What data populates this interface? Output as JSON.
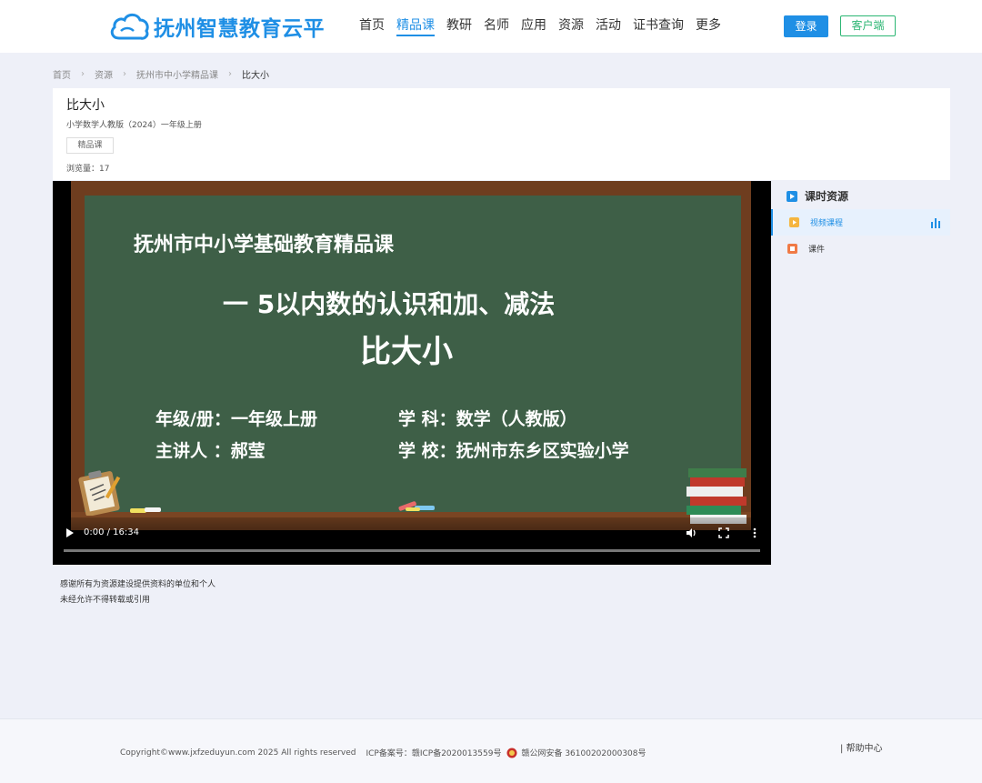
{
  "header": {
    "logo_text": "抚州智慧教育云平",
    "nav": [
      "首页",
      "精品课",
      "教研",
      "名师",
      "应用",
      "资源",
      "活动",
      "证书查询",
      "更多"
    ],
    "active_nav": "精品课",
    "login_label": "登录",
    "client_label": "客户端",
    "accent_color": "#1f8fe5",
    "client_color": "#2bb673"
  },
  "breadcrumb": [
    "首页",
    "资源",
    "抚州市中小学精品课",
    "比大小"
  ],
  "lesson": {
    "title": "比大小",
    "subtitle": "小学数学人教版（2024）一年级上册",
    "tag": "精品课",
    "views": "浏览量：17"
  },
  "video": {
    "series": "抚州市中小学基础教育精品课",
    "unit": "一  5以内数的认识和加、减法",
    "title": "比大小",
    "grade": "年级/册：一年级上册",
    "subject": "学  科：数学（人教版）",
    "teacher": "主讲人 ：郝莹",
    "school": "学  校：抚州市东乡区实验小学",
    "time": "0:00 / 16:34",
    "progress": 0
  },
  "side_panel": {
    "header": "课时资源",
    "items": [
      {
        "label": "视频课程",
        "active": true
      },
      {
        "label": "课件",
        "active": false
      }
    ]
  },
  "notes": [
    "感谢所有为资源建设提供资料的单位和个人",
    "未经允许不得转载或引用"
  ],
  "footer": {
    "copyright": "Copyright©www.jxfzeduyun.com 2025 All rights reserved",
    "icp": "ICP备案号：赣ICP备2020013559号",
    "police": "赣公网安备 36100202000308号",
    "help": "|    帮助中心"
  }
}
